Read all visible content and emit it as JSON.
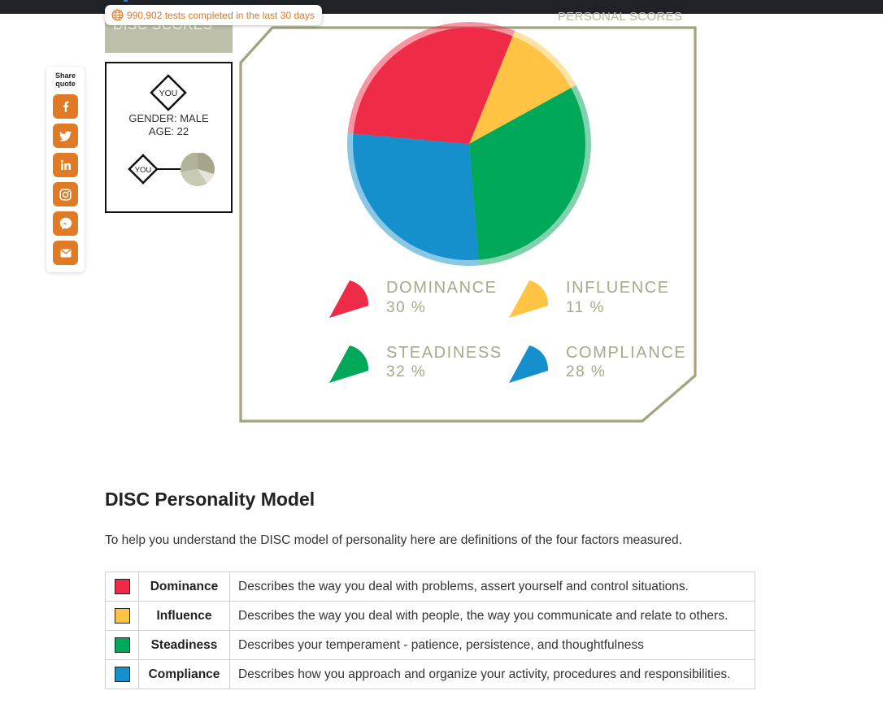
{
  "banner": {
    "counter_text": "990,902 tests completed in the last 30 days"
  },
  "sidebar_tab": {
    "label": "DISC SCORES"
  },
  "profile": {
    "you_label": "YOU",
    "gender": "GENDER: MALE",
    "age": "AGE: 22"
  },
  "share": {
    "title_line1": "Share",
    "title_line2": "quote",
    "buttons": [
      {
        "icon": "facebook-icon"
      },
      {
        "icon": "twitter-icon"
      },
      {
        "icon": "linkedin-icon"
      },
      {
        "icon": "instagram-icon"
      },
      {
        "icon": "messenger-icon"
      },
      {
        "icon": "email-icon"
      }
    ]
  },
  "scores": {
    "header": "PERSONAL SCORES",
    "items": [
      {
        "name": "DOMINANCE",
        "percent": "30 %",
        "value": 30,
        "color": "#ef2b48"
      },
      {
        "name": "INFLUENCE",
        "percent": "11 %",
        "value": 11,
        "color": "#ffc444"
      },
      {
        "name": "STEADINESS",
        "percent": "32 %",
        "value": 32,
        "color": "#00a859"
      },
      {
        "name": "COMPLIANCE",
        "percent": "28 %",
        "value": 28,
        "color": "#1590cc"
      }
    ]
  },
  "model": {
    "title": "DISC Personality Model",
    "intro": "To help you understand the DISC model of personality here are definitions of the four factors measured.",
    "rows": [
      {
        "name": "Dominance",
        "color": "#ef2b48",
        "description": "Describes the way you deal with problems, assert yourself and control situations."
      },
      {
        "name": "Influence",
        "color": "#ffc444",
        "description": "Describes the way you deal with people, the way you communicate and relate to others."
      },
      {
        "name": "Steadiness",
        "color": "#00a859",
        "description": "Describes your temperament - patience, persistence, and thoughtfulness"
      },
      {
        "name": "Compliance",
        "color": "#1590cc",
        "description": "Describes how you approach and organize your activity, procedures and responsibilities."
      }
    ]
  }
}
